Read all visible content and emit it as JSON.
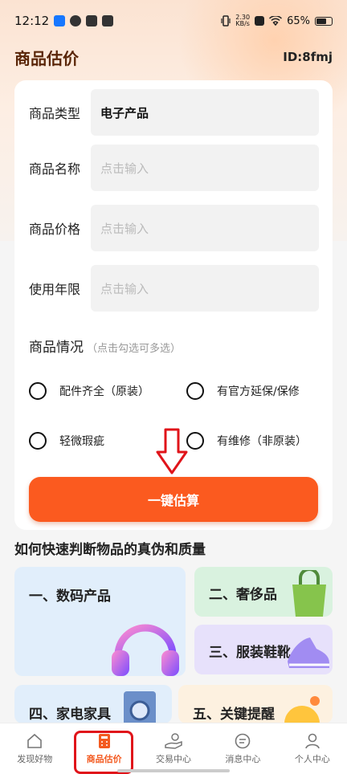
{
  "status_bar": {
    "time": "12:12",
    "speed": "2.30",
    "speed_unit": "KB/s",
    "battery": "65%"
  },
  "header": {
    "title": "商品估价",
    "id_text": "ID:8fmj"
  },
  "form": {
    "fields": [
      {
        "label": "商品类型",
        "value": "电子产品",
        "placeholder": ""
      },
      {
        "label": "商品名称",
        "value": "",
        "placeholder": "点击输入"
      },
      {
        "label": "商品价格",
        "value": "",
        "placeholder": "点击输入"
      },
      {
        "label": "使用年限",
        "value": "",
        "placeholder": "点击输入"
      }
    ],
    "condition_title": "商品情况",
    "condition_hint": "（点击勾选可多选）",
    "options": [
      "配件齐全（原装）",
      "有官方延保/保修",
      "轻微瑕疵",
      "有维修（非原装）"
    ],
    "submit_label": "一键估算"
  },
  "guide": {
    "title": "如何快速判断物品的真伪和质量",
    "tiles": [
      "一、数码产品",
      "二、奢侈品",
      "三、服装鞋靴",
      "四、家电家具",
      "五、关键提醒"
    ]
  },
  "tabbar": {
    "items": [
      "发现好物",
      "商品估价",
      "交易中心",
      "消息中心",
      "个人中心"
    ],
    "active_index": 1,
    "active_color": "#f35a20"
  },
  "colors": {
    "accent": "#fb5a1f",
    "title": "#5a2608",
    "highlight_box": "#e0141a"
  }
}
